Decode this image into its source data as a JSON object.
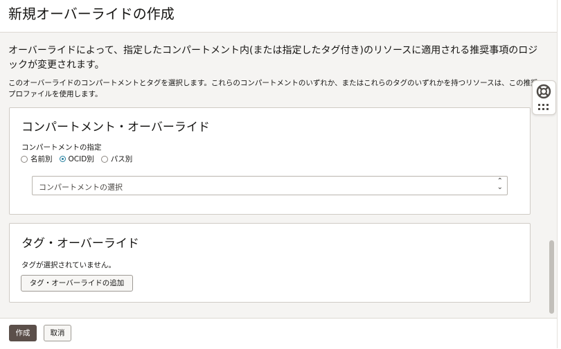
{
  "header": {
    "title": "新規オーバーライドの作成"
  },
  "intro": {
    "text": "オーバーライドによって、指定したコンパートメント内(または指定したタグ付き)のリソースに適用される推奨事項のロジックが変更されます。",
    "sub": "このオーバーライドのコンパートメントとタグを選択します。これらのコンパートメントのいずれか、またはこれらのタグのいずれかを持つリソースは、この推奨プロファイルを使用します。"
  },
  "compartment_panel": {
    "heading": "コンパートメント・オーバーライド",
    "field_label": "コンパートメントの指定",
    "radio_options": [
      "名前別",
      "OCID別",
      "パス別"
    ],
    "selected_option": "OCID別",
    "select_placeholder": "コンパートメントの選択"
  },
  "tag_panel": {
    "heading": "タグ・オーバーライド",
    "empty_text": "タグが選択されていません。",
    "add_button": "タグ・オーバーライドの追加"
  },
  "footer": {
    "create_button": "作成",
    "cancel_button": "取消"
  },
  "icons": {
    "help": "life-ring-icon",
    "apps": "grid-dots-icon"
  },
  "colors": {
    "primary_button": "#5b4f4a",
    "radio_selected": "#227e9e",
    "content_bg": "#f5f4f2"
  }
}
